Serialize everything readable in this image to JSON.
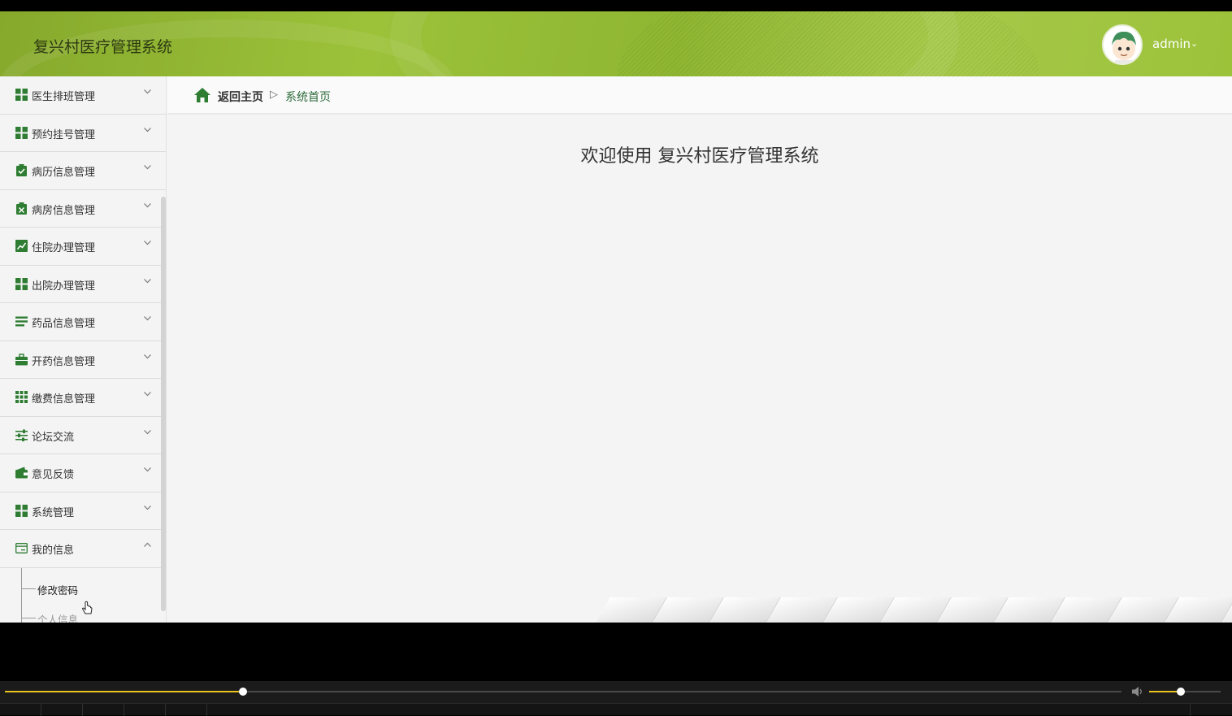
{
  "header": {
    "app_title": "复兴村医疗管理系统",
    "user_name": "admin",
    "user_caret": "⌄"
  },
  "sidebar": {
    "items": [
      {
        "label": "医生排班管理",
        "icon": "grid-icon",
        "expanded": false
      },
      {
        "label": "预约挂号管理",
        "icon": "grid-icon",
        "expanded": false
      },
      {
        "label": "病历信息管理",
        "icon": "clipboard-check-icon",
        "expanded": false
      },
      {
        "label": "病房信息管理",
        "icon": "clipboard-x-icon",
        "expanded": false
      },
      {
        "label": "住院办理管理",
        "icon": "chart-line-icon",
        "expanded": false
      },
      {
        "label": "出院办理管理",
        "icon": "grid-icon",
        "expanded": false
      },
      {
        "label": "药品信息管理",
        "icon": "list-icon",
        "expanded": false
      },
      {
        "label": "开药信息管理",
        "icon": "briefcase-icon",
        "expanded": false
      },
      {
        "label": "缴费信息管理",
        "icon": "grid-nine-icon",
        "expanded": false
      },
      {
        "label": "论坛交流",
        "icon": "sliders-icon",
        "expanded": false
      },
      {
        "label": "意见反馈",
        "icon": "wallet-icon",
        "expanded": false
      },
      {
        "label": "系统管理",
        "icon": "grid-icon",
        "expanded": false
      },
      {
        "label": "我的信息",
        "icon": "id-card-icon",
        "expanded": true
      }
    ],
    "sub_items": [
      {
        "label": "修改密码"
      },
      {
        "label": "个人信息"
      }
    ]
  },
  "breadcrumb": {
    "home": "返回主页",
    "separator": "▷",
    "current": "系统首页"
  },
  "main": {
    "welcome": "欢迎使用 复兴村医疗管理系统"
  },
  "player": {
    "progress": 0.213,
    "volume": 0.44
  },
  "colors": {
    "header_green": "#9cc23a",
    "icon_green": "#2e7d32",
    "progress_yellow": "#e8c320"
  }
}
